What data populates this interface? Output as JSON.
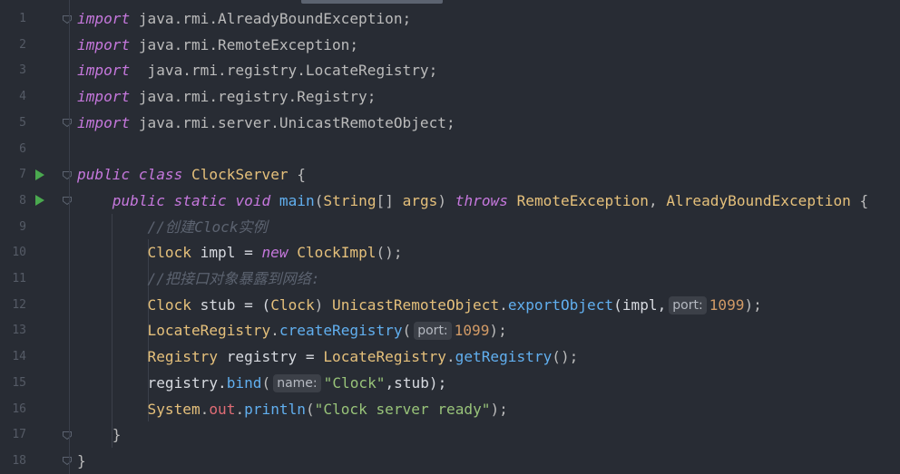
{
  "editor": {
    "line_numbers": [
      "1",
      "2",
      "3",
      "4",
      "5",
      "6",
      "7",
      "8",
      "9",
      "10",
      "11",
      "12",
      "13",
      "14",
      "15",
      "16",
      "17",
      "18"
    ],
    "run_markers": [
      7,
      8
    ],
    "fold_markers": [
      1,
      5,
      7,
      8,
      17,
      18
    ],
    "lines": [
      [
        {
          "t": "import",
          "c": "kwi"
        },
        {
          "t": " java.rmi.AlreadyBoundException;",
          "c": "pkg"
        }
      ],
      [
        {
          "t": "import",
          "c": "kwi"
        },
        {
          "t": " java.rmi.RemoteException;",
          "c": "pkg"
        }
      ],
      [
        {
          "t": "import",
          "c": "kwi"
        },
        {
          "t": "  java.rmi.registry.LocateRegistry;",
          "c": "pkg"
        }
      ],
      [
        {
          "t": "import",
          "c": "kwi"
        },
        {
          "t": " java.rmi.registry.Registry;",
          "c": "pkg"
        }
      ],
      [
        {
          "t": "import",
          "c": "kwi"
        },
        {
          "t": " java.rmi.server.UnicastRemoteObject;",
          "c": "pkg"
        }
      ],
      [],
      [
        {
          "t": "public",
          "c": "kwi"
        },
        {
          "t": " ",
          "c": "punc"
        },
        {
          "t": "class",
          "c": "kwi"
        },
        {
          "t": " ",
          "c": "punc"
        },
        {
          "t": "ClockServer",
          "c": "cls"
        },
        {
          "t": " {",
          "c": "punc"
        }
      ],
      [
        {
          "t": "    ",
          "c": "punc"
        },
        {
          "t": "public",
          "c": "kwi"
        },
        {
          "t": " ",
          "c": "punc"
        },
        {
          "t": "static",
          "c": "kwi"
        },
        {
          "t": " ",
          "c": "punc"
        },
        {
          "t": "void",
          "c": "kwi"
        },
        {
          "t": " ",
          "c": "punc"
        },
        {
          "t": "main",
          "c": "fn"
        },
        {
          "t": "(",
          "c": "punc"
        },
        {
          "t": "String",
          "c": "cls"
        },
        {
          "t": "[] ",
          "c": "punc"
        },
        {
          "t": "args",
          "c": "param"
        },
        {
          "t": ") ",
          "c": "punc"
        },
        {
          "t": "throws",
          "c": "kwi"
        },
        {
          "t": " ",
          "c": "punc"
        },
        {
          "t": "RemoteException",
          "c": "cls"
        },
        {
          "t": ", ",
          "c": "punc"
        },
        {
          "t": "AlreadyBoundException",
          "c": "cls"
        },
        {
          "t": " {",
          "c": "punc"
        }
      ],
      [
        {
          "t": "        ",
          "c": "punc"
        },
        {
          "t": "//创建Clock实例",
          "c": "cmt"
        }
      ],
      [
        {
          "t": "        ",
          "c": "punc"
        },
        {
          "t": "Clock",
          "c": "cls"
        },
        {
          "t": " impl = ",
          "c": "var"
        },
        {
          "t": "new",
          "c": "kwi"
        },
        {
          "t": " ",
          "c": "punc"
        },
        {
          "t": "ClockImpl",
          "c": "cls"
        },
        {
          "t": "();",
          "c": "punc"
        }
      ],
      [
        {
          "t": "        ",
          "c": "punc"
        },
        {
          "t": "//把接口对象暴露到网络:",
          "c": "cmt"
        }
      ],
      [
        {
          "t": "        ",
          "c": "punc"
        },
        {
          "t": "Clock",
          "c": "cls"
        },
        {
          "t": " stub = (",
          "c": "var"
        },
        {
          "t": "Clock",
          "c": "cls"
        },
        {
          "t": ") ",
          "c": "punc"
        },
        {
          "t": "UnicastRemoteObject",
          "c": "cls"
        },
        {
          "t": ".",
          "c": "punc"
        },
        {
          "t": "exportObject",
          "c": "fn"
        },
        {
          "t": "(impl,",
          "c": "var"
        },
        {
          "t": "port:",
          "c": "hint"
        },
        {
          "t": "1099",
          "c": "num"
        },
        {
          "t": ");",
          "c": "punc"
        }
      ],
      [
        {
          "t": "        ",
          "c": "punc"
        },
        {
          "t": "LocateRegistry",
          "c": "cls"
        },
        {
          "t": ".",
          "c": "punc"
        },
        {
          "t": "createRegistry",
          "c": "fn"
        },
        {
          "t": "(",
          "c": "punc"
        },
        {
          "t": "port:",
          "c": "hint"
        },
        {
          "t": "1099",
          "c": "num"
        },
        {
          "t": ");",
          "c": "punc"
        }
      ],
      [
        {
          "t": "        ",
          "c": "punc"
        },
        {
          "t": "Registry",
          "c": "cls"
        },
        {
          "t": " registry = ",
          "c": "var"
        },
        {
          "t": "LocateRegistry",
          "c": "cls"
        },
        {
          "t": ".",
          "c": "punc"
        },
        {
          "t": "getRegistry",
          "c": "fn"
        },
        {
          "t": "();",
          "c": "punc"
        }
      ],
      [
        {
          "t": "        ",
          "c": "punc"
        },
        {
          "t": "registry.",
          "c": "var"
        },
        {
          "t": "bind",
          "c": "fn"
        },
        {
          "t": "(",
          "c": "punc"
        },
        {
          "t": "name:",
          "c": "hint"
        },
        {
          "t": "\"Clock\"",
          "c": "str"
        },
        {
          "t": ",stub);",
          "c": "var"
        }
      ],
      [
        {
          "t": "        ",
          "c": "punc"
        },
        {
          "t": "System",
          "c": "cls"
        },
        {
          "t": ".",
          "c": "punc"
        },
        {
          "t": "out",
          "c": "field"
        },
        {
          "t": ".",
          "c": "punc"
        },
        {
          "t": "println",
          "c": "fn"
        },
        {
          "t": "(",
          "c": "punc"
        },
        {
          "t": "\"Clock server ready\"",
          "c": "str"
        },
        {
          "t": ");",
          "c": "punc"
        }
      ],
      [
        {
          "t": "    }",
          "c": "punc"
        }
      ],
      [
        {
          "t": "}",
          "c": "punc"
        }
      ]
    ]
  },
  "colors": {
    "background": "#282c34",
    "keyword": "#c678dd",
    "class_name": "#e5c07b",
    "method": "#61afef",
    "string": "#98c379",
    "number": "#d19a66",
    "comment": "#5c6370",
    "run_marker": "#4aa94f"
  }
}
